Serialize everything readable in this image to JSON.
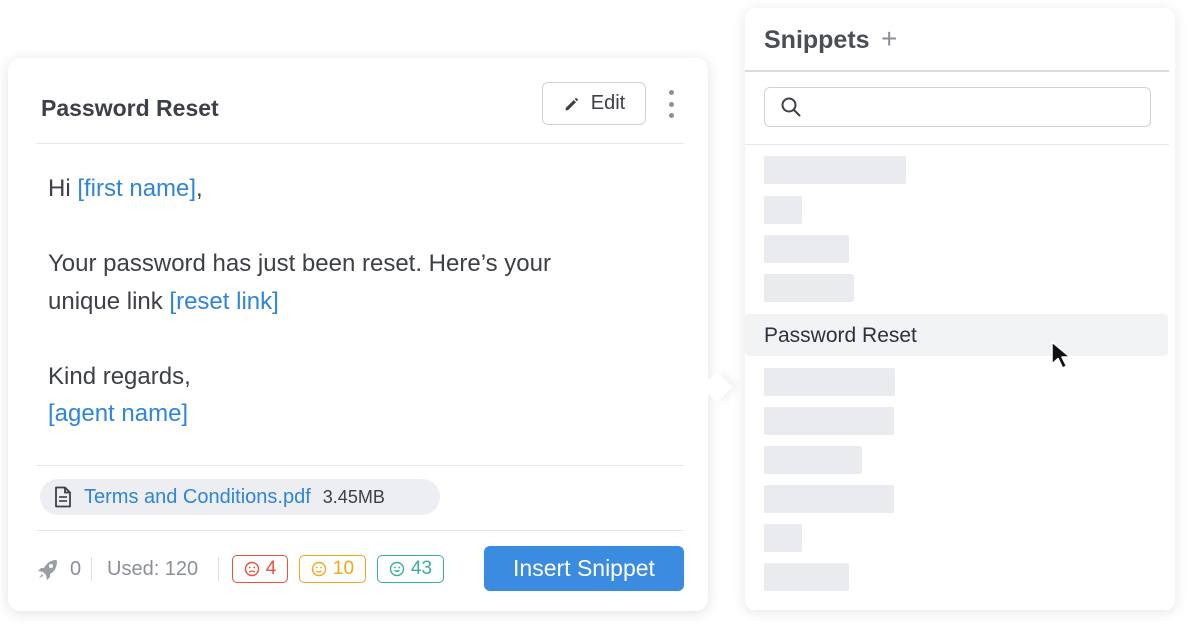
{
  "preview": {
    "title": "Password Reset",
    "edit_label": "Edit",
    "body": {
      "greeting_prefix": "Hi ",
      "first_name_var": "[first name]",
      "greeting_suffix": ",",
      "line2a": "Your password has just been reset. Here’s your",
      "line2b_prefix": "unique link ",
      "reset_link_var": "[reset link]",
      "closing": "Kind regards,",
      "agent_name_var": "[agent name]"
    },
    "attachment": {
      "name": "Terms and Conditions.pdf",
      "size": "3.45MB",
      "icon": "document-icon"
    },
    "footer": {
      "rocket_count": "0",
      "used_label": "Used: 120",
      "ratings": {
        "sad": "4",
        "neutral": "10",
        "happy": "43"
      },
      "insert_label": "Insert Snippet"
    }
  },
  "snippets": {
    "title": "Snippets",
    "add_symbol": "+",
    "search": {
      "value": "",
      "placeholder": ""
    },
    "active_item": "Password Reset"
  },
  "colors": {
    "accent": "#3b8be0",
    "variable": "#2f85d8",
    "sad": "#e5533d",
    "neutral": "#f0a61f",
    "happy": "#3aaea2"
  }
}
